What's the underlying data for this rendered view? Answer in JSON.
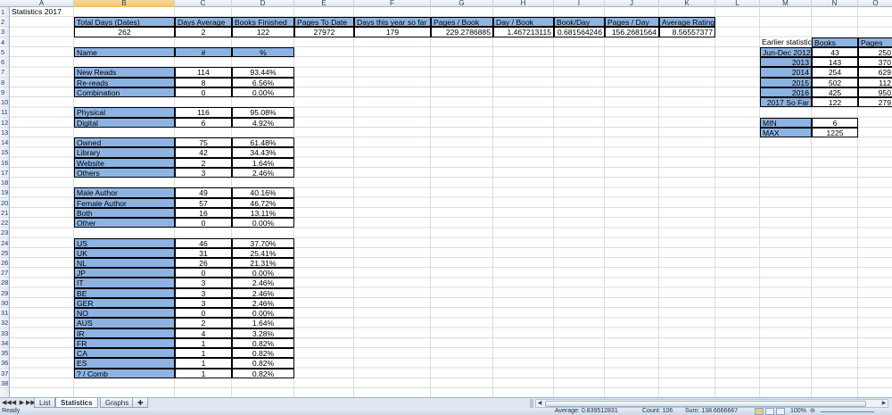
{
  "columns": [
    "A",
    "B",
    "C",
    "D",
    "E",
    "F",
    "G",
    "H",
    "I",
    "J",
    "K",
    "L",
    "M",
    "N",
    "O"
  ],
  "rows": [
    "1",
    "2",
    "3",
    "4",
    "5",
    "6",
    "7",
    "8",
    "9",
    "10",
    "11",
    "12",
    "13",
    "14",
    "15",
    "16",
    "17",
    "18",
    "19",
    "20",
    "21",
    "22",
    "23",
    "24",
    "25",
    "26",
    "27",
    "28",
    "29",
    "30",
    "31",
    "32",
    "33",
    "34",
    "35",
    "36",
    "37",
    "38"
  ],
  "title": "Statistics 2017",
  "summary": {
    "headers": [
      "Total Days (Dates)",
      "Days Average",
      "Books Finished",
      "Pages To Date",
      "Days this year so far",
      "Pages / Book",
      "Day / Book",
      "Book/Day",
      "Pages / Day",
      "Average Rating"
    ],
    "values": [
      "262",
      "2",
      "122",
      "27972",
      "179",
      "229.2786885",
      "1.467213115",
      "0.681564246",
      "156.2681564",
      "8.56557377"
    ]
  },
  "table_header": {
    "name": "Name",
    "count": "#",
    "percent": "%"
  },
  "groups": [
    [
      {
        "name": "New Reads",
        "count": "114",
        "pct": "93.44%"
      },
      {
        "name": "Re-reads",
        "count": "8",
        "pct": "6.56%"
      },
      {
        "name": "Combination",
        "count": "0",
        "pct": "0.00%"
      }
    ],
    [
      {
        "name": "Physical",
        "count": "116",
        "pct": "95.08%"
      },
      {
        "name": "Digital",
        "count": "6",
        "pct": "4.92%"
      }
    ],
    [
      {
        "name": "Owned",
        "count": "75",
        "pct": "61.48%"
      },
      {
        "name": "Library",
        "count": "42",
        "pct": "34.43%"
      },
      {
        "name": "Website",
        "count": "2",
        "pct": "1.64%"
      },
      {
        "name": "Others",
        "count": "3",
        "pct": "2.46%"
      }
    ],
    [
      {
        "name": "Male Author",
        "count": "49",
        "pct": "40.16%"
      },
      {
        "name": "Female Author",
        "count": "57",
        "pct": "46.72%"
      },
      {
        "name": "Both",
        "count": "16",
        "pct": "13.11%"
      },
      {
        "name": "Other",
        "count": "0",
        "pct": "0.00%"
      }
    ],
    [
      {
        "name": "US",
        "count": "46",
        "pct": "37.70%"
      },
      {
        "name": "UK",
        "count": "31",
        "pct": "25.41%"
      },
      {
        "name": "NL",
        "count": "26",
        "pct": "21.31%"
      },
      {
        "name": "JP",
        "count": "0",
        "pct": "0.00%"
      },
      {
        "name": "IT",
        "count": "3",
        "pct": "2.46%"
      },
      {
        "name": "BE",
        "count": "3",
        "pct": "2.46%"
      },
      {
        "name": "GER",
        "count": "3",
        "pct": "2.46%"
      },
      {
        "name": "NO",
        "count": "0",
        "pct": "0.00%"
      },
      {
        "name": "AUS",
        "count": "2",
        "pct": "1.64%"
      },
      {
        "name": "IR",
        "count": "4",
        "pct": "3.28%"
      },
      {
        "name": "FR",
        "count": "1",
        "pct": "0.82%"
      },
      {
        "name": "CA",
        "count": "1",
        "pct": "0.82%"
      },
      {
        "name": "ES",
        "count": "1",
        "pct": "0.82%"
      },
      {
        "name": "? / Comb",
        "count": "1",
        "pct": "0.82%"
      }
    ]
  ],
  "earlier": {
    "label": "Earlier statistic",
    "col_books": "Books",
    "col_pages": "Pages",
    "rows": [
      {
        "period": "Jun-Dec 2012",
        "books": "43",
        "pages": "250"
      },
      {
        "period": "2013",
        "books": "143",
        "pages": "370"
      },
      {
        "period": "2014",
        "books": "254",
        "pages": "629"
      },
      {
        "period": "2015",
        "books": "502",
        "pages": "112"
      },
      {
        "period": "2016",
        "books": "425",
        "pages": "950"
      },
      {
        "period": "2017 So Far",
        "books": "122",
        "pages": "279"
      }
    ],
    "min_label": "MIN",
    "min_value": "6",
    "max_label": "MAX",
    "max_value": "1225"
  },
  "tabs": {
    "nav": [
      "◀◀",
      "◀",
      "▶",
      "▶▶"
    ],
    "items": [
      {
        "label": "List",
        "active": false
      },
      {
        "label": "Statistics",
        "active": true
      },
      {
        "label": "Graphs",
        "active": false
      }
    ]
  },
  "status": {
    "ready": "Ready",
    "average": "Average: 0.839512831",
    "count": "Count: 106",
    "sum": "Sum: 138.6666667",
    "zoom": "100%"
  },
  "icons": {
    "new_sheet": "new-sheet-icon",
    "zoom_out": "zoom-out-icon"
  }
}
